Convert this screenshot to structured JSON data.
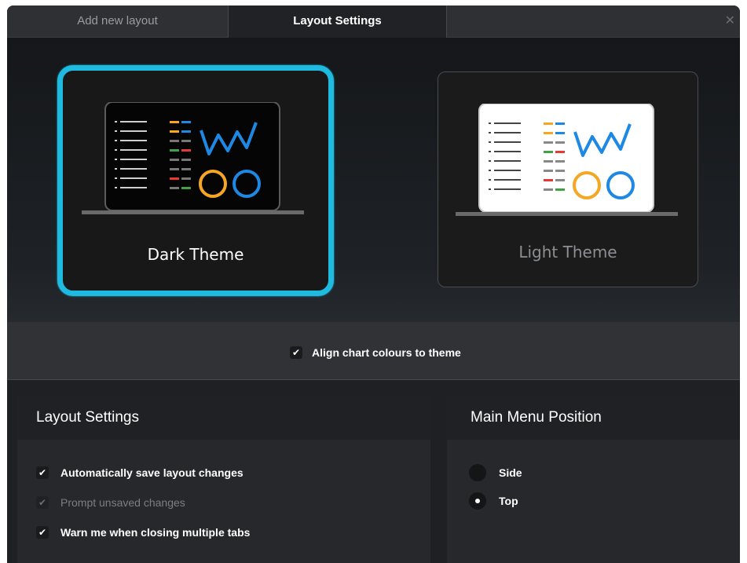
{
  "tabs": [
    {
      "label": "Add new layout",
      "active": false
    },
    {
      "label": "Layout Settings",
      "active": true
    }
  ],
  "close_icon": "close-icon",
  "themes": [
    {
      "label": "Dark Theme",
      "selected": true
    },
    {
      "label": "Light Theme",
      "selected": false
    }
  ],
  "align": {
    "label": "Align chart colours to theme",
    "checked": true
  },
  "layout_settings": {
    "title": "Layout Settings",
    "options": [
      {
        "label": "Automatically save layout changes",
        "checked": true,
        "enabled": true
      },
      {
        "label": "Prompt unsaved changes",
        "checked": true,
        "enabled": false
      },
      {
        "label": "Warn me when closing multiple tabs",
        "checked": true,
        "enabled": true
      }
    ]
  },
  "menu_position": {
    "title": "Main Menu Position",
    "options": [
      {
        "label": "Side",
        "selected": false
      },
      {
        "label": "Top",
        "selected": true
      }
    ]
  },
  "colors": {
    "accent": "#1ebae0",
    "orange": "#f5a623",
    "blue": "#1e88e5",
    "red": "#e53935",
    "green": "#43a047"
  }
}
